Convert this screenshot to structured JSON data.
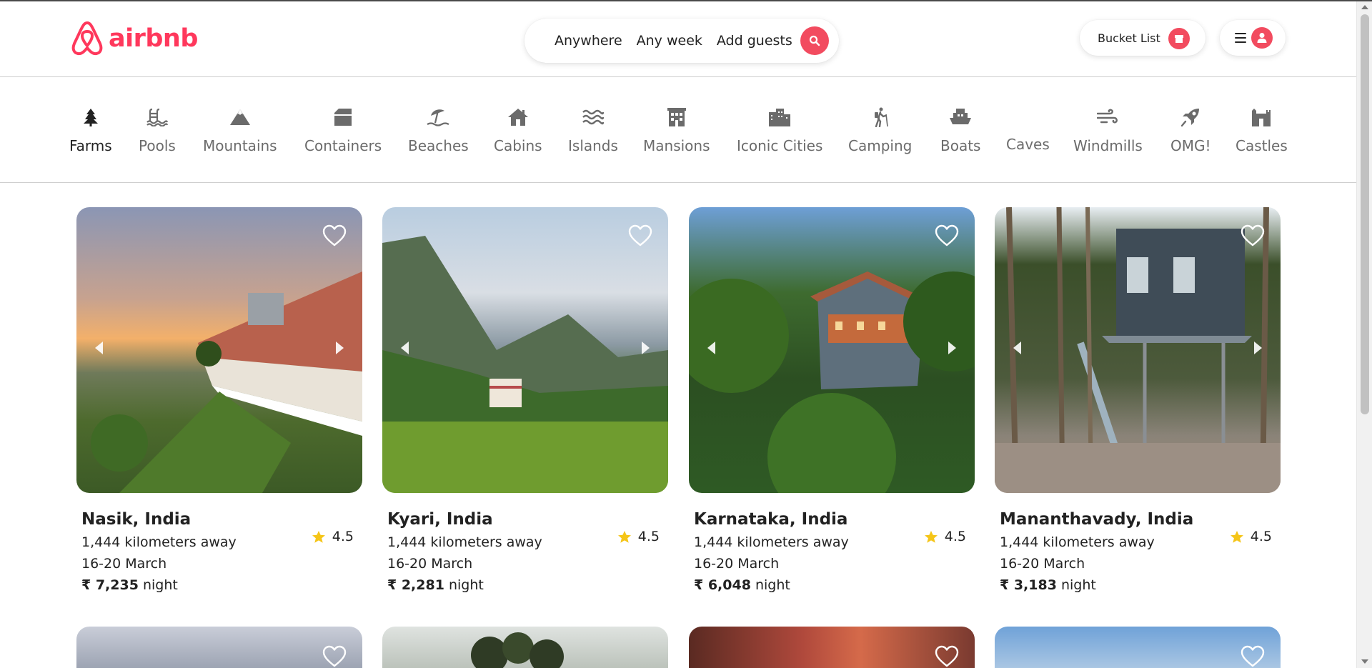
{
  "brand": {
    "name": "airbnb",
    "accent": "#ff385c"
  },
  "search": {
    "where": "Anywhere",
    "when": "Any week",
    "who": "Add guests",
    "icon": "search-icon"
  },
  "header": {
    "bucket_label": "Bucket List",
    "bucket_icon": "bucket-icon",
    "menu_icon": "hamburger-icon",
    "avatar_icon": "user-icon"
  },
  "categories": [
    {
      "label": "Farms",
      "icon": "tree-icon",
      "active": true
    },
    {
      "label": "Pools",
      "icon": "pool-icon"
    },
    {
      "label": "Mountains",
      "icon": "mountain-icon"
    },
    {
      "label": "Containers",
      "icon": "container-icon"
    },
    {
      "label": "Beaches",
      "icon": "umbrella-icon"
    },
    {
      "label": "Cabins",
      "icon": "cabin-icon"
    },
    {
      "label": "Islands",
      "icon": "waves-icon"
    },
    {
      "label": "Mansions",
      "icon": "mansion-icon"
    },
    {
      "label": "Iconic Cities",
      "icon": "city-icon"
    },
    {
      "label": "Camping",
      "icon": "hiker-icon"
    },
    {
      "label": "Boats",
      "icon": "boat-icon"
    },
    {
      "label": "Caves",
      "icon": "cave-icon"
    },
    {
      "label": "Windmills",
      "icon": "wind-icon"
    },
    {
      "label": "OMG!",
      "icon": "rocket-icon"
    },
    {
      "label": "Castles",
      "icon": "castle-icon"
    }
  ],
  "listings": [
    {
      "title": "Nasik, India",
      "rating": "4.5",
      "distance": "1,444 kilometers away",
      "dates": "16-20 March",
      "price": "₹ 7,235",
      "price_unit": "night"
    },
    {
      "title": "Kyari, India",
      "rating": "4.5",
      "distance": "1,444 kilometers away",
      "dates": "16-20 March",
      "price": "₹ 2,281",
      "price_unit": "night"
    },
    {
      "title": "Karnataka, India",
      "rating": "4.5",
      "distance": "1,444 kilometers away",
      "dates": "16-20 March",
      "price": "₹ 6,048",
      "price_unit": "night"
    },
    {
      "title": "Mananthavady, India",
      "rating": "4.5",
      "distance": "1,444 kilometers away",
      "dates": "16-20 March",
      "price": "₹ 3,183",
      "price_unit": "night"
    }
  ],
  "colors": {
    "accent": "#f24b5f",
    "star": "#f5c518",
    "muted_text": "#6b6b6b"
  }
}
